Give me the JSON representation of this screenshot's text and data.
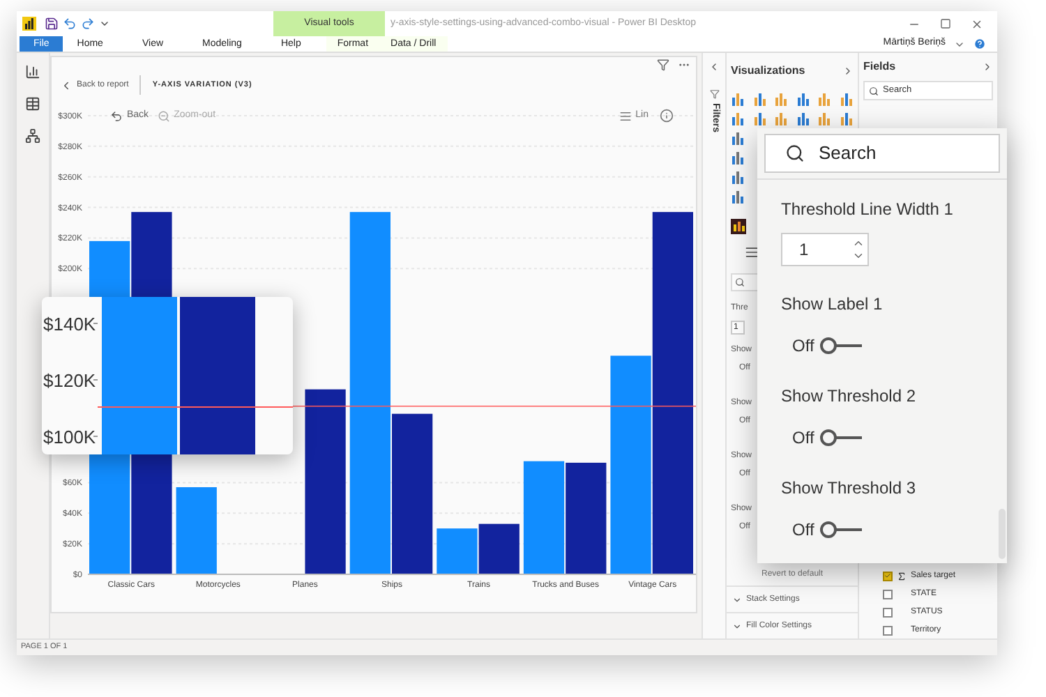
{
  "window": {
    "title": "y-axis-style-settings-using-advanced-combo-visual - Power BI Desktop",
    "contextual_group": "Visual tools",
    "user": "Mārtiņš Beriņš"
  },
  "ribbon_tabs": [
    {
      "label": "File",
      "kind": "file"
    },
    {
      "label": "Home",
      "kind": "plain"
    },
    {
      "label": "View",
      "kind": "plain"
    },
    {
      "label": "Modeling",
      "kind": "plain"
    },
    {
      "label": "Help",
      "kind": "plain"
    },
    {
      "label": "Format",
      "kind": "contextual"
    },
    {
      "label": "Data / Drill",
      "kind": "contextual"
    }
  ],
  "report": {
    "back_link": "Back to report",
    "visual_title": "Y-AXIS VARIATION (V3)",
    "toolbar": [
      {
        "label": "Back",
        "disabled": false
      },
      {
        "label": "Zoom-out",
        "disabled": true
      }
    ],
    "scale_toggle": "Lin",
    "chart_data": {
      "type": "bar",
      "categories": [
        "Classic Cars",
        "Motorcycles",
        "Planes",
        "Ships",
        "Trains",
        "Trucks and Buses",
        "Vintage Cars"
      ],
      "series": [
        {
          "color": "#118dff",
          "values": [
            218000,
            57000,
            null,
            237000,
            30000,
            74000,
            143000
          ]
        },
        {
          "color": "#12239e",
          "values": [
            237000,
            null,
            121000,
            105000,
            33000,
            73000,
            237000
          ]
        }
      ],
      "grid": true,
      "ylim": [
        0,
        300000
      ],
      "yticks": [
        {
          "value": 0,
          "label": "$0"
        },
        {
          "value": 20000,
          "label": "$20K"
        },
        {
          "value": 40000,
          "label": "$40K"
        },
        {
          "value": 60000,
          "label": "$60K"
        },
        {
          "value": 200000,
          "label": "$200K"
        },
        {
          "value": 220000,
          "label": "$220K"
        },
        {
          "value": 240000,
          "label": "$240K"
        },
        {
          "value": 260000,
          "label": "$260K"
        },
        {
          "value": 280000,
          "label": "$280K"
        },
        {
          "value": 300000,
          "label": "$300K"
        }
      ],
      "ref_lines": [
        {
          "axis": "y",
          "value": 110000,
          "color": "#ff5a5a"
        }
      ]
    }
  },
  "magnifier": {
    "tick_labels": [
      "$140K",
      "$120K",
      "$100K"
    ]
  },
  "filters_pane": {
    "label": "Filters"
  },
  "visualizations_pane": {
    "title": "Visualizations",
    "partial_items": [
      {
        "kind": "number",
        "label": "Thre",
        "value": "1"
      },
      {
        "kind": "toggle",
        "label": "Show",
        "value": "Off"
      },
      {
        "kind": "toggle",
        "label": "Show",
        "value": "Off"
      },
      {
        "kind": "toggle",
        "label": "Show",
        "value": "Off"
      },
      {
        "kind": "toggle",
        "label": "Show",
        "value": "Off"
      }
    ],
    "revert": "Revert to default",
    "sections": [
      "Stack Settings",
      "Fill Color Settings"
    ]
  },
  "fields_pane": {
    "title": "Fields",
    "search_placeholder": "Search",
    "fields": [
      {
        "name": "Sales target",
        "checked": true,
        "kind": "measure"
      },
      {
        "name": "STATE",
        "checked": false,
        "kind": "column"
      },
      {
        "name": "STATUS",
        "checked": false,
        "kind": "column"
      },
      {
        "name": "Territory",
        "checked": false,
        "kind": "column"
      }
    ]
  },
  "settings_popup": {
    "search_placeholder": "Search",
    "items": [
      {
        "kind": "number",
        "label": "Threshold Line Width 1",
        "value": "1"
      },
      {
        "kind": "toggle",
        "label": "Show Label 1",
        "on": false,
        "state_text": "Off"
      },
      {
        "kind": "toggle",
        "label": "Show Threshold 2",
        "on": false,
        "state_text": "Off"
      },
      {
        "kind": "toggle",
        "label": "Show Threshold 3",
        "on": false,
        "state_text": "Off"
      }
    ]
  },
  "status_bar": {
    "page": "PAGE 1 OF 1"
  }
}
